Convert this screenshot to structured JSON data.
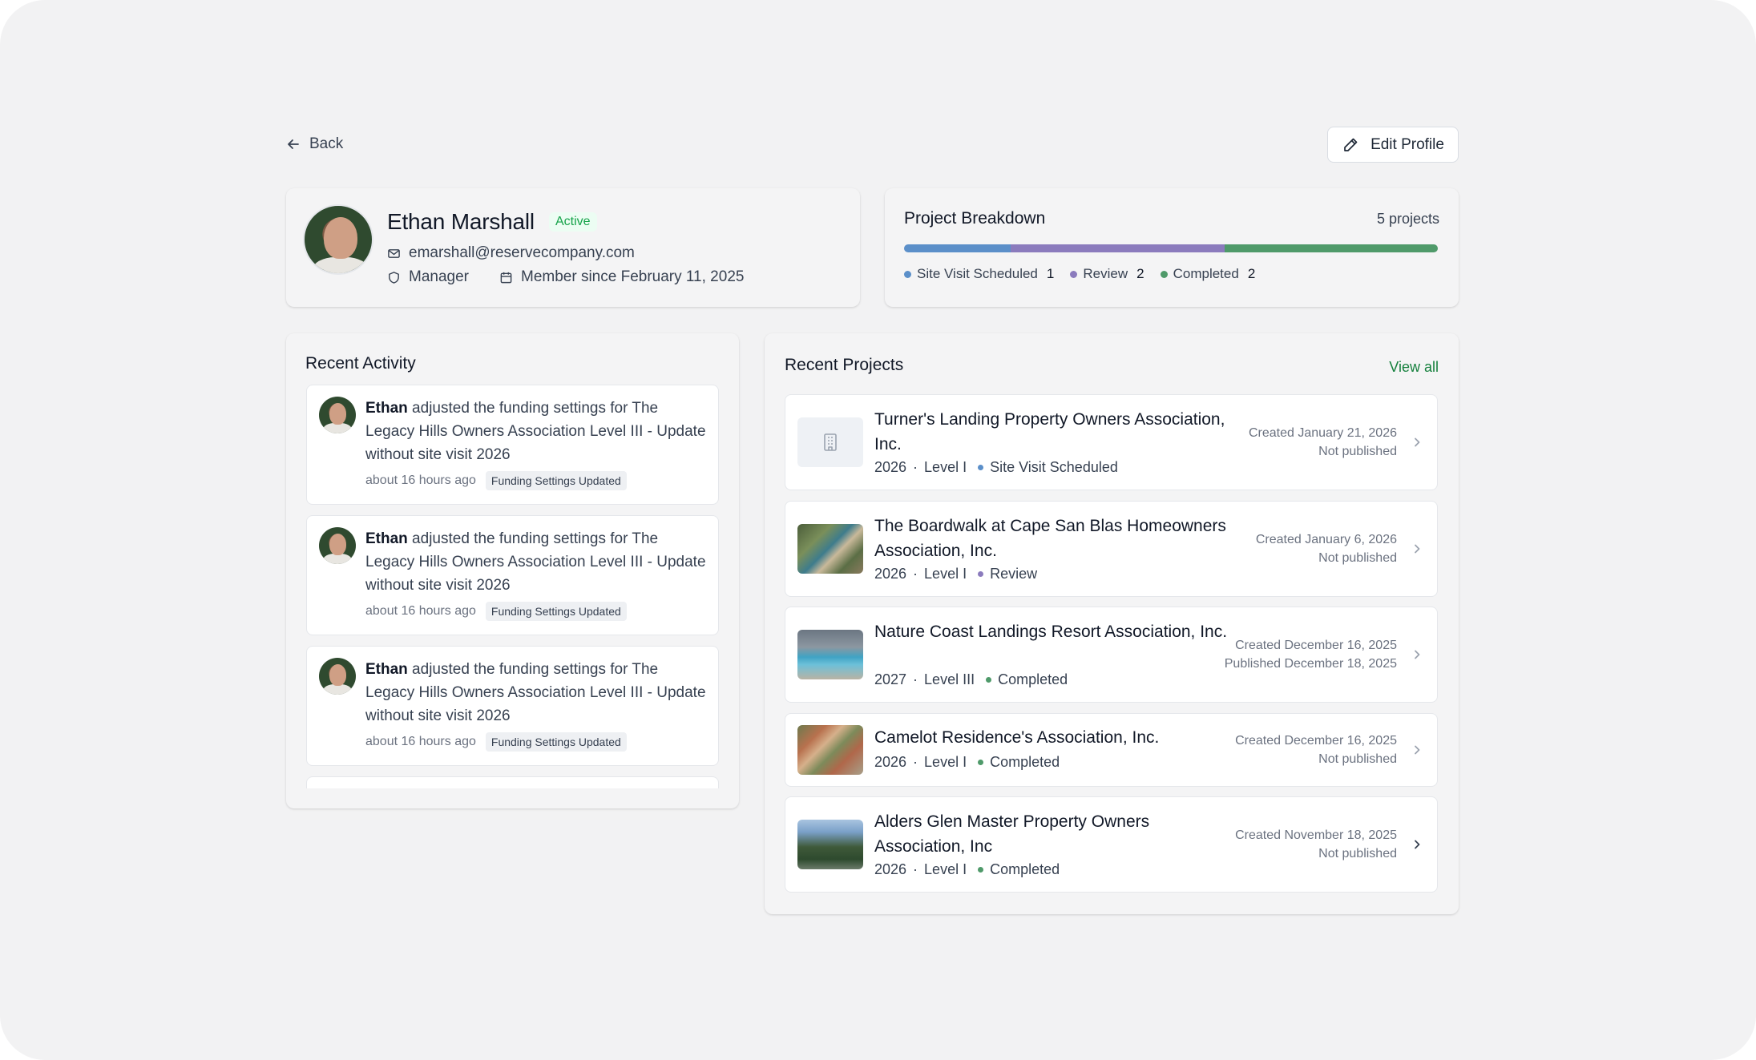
{
  "nav": {
    "back_label": "Back",
    "edit_profile_label": "Edit Profile"
  },
  "profile": {
    "name": "Ethan Marshall",
    "status": "Active",
    "email": "emarshall@reservecompany.com",
    "role": "Manager",
    "member_since": "Member since February 11, 2025"
  },
  "breakdown": {
    "title": "Project Breakdown",
    "count_label": "5 projects",
    "segments": [
      {
        "label": "Site Visit Scheduled",
        "count": "1",
        "value": 1,
        "color": "#5b8fc9"
      },
      {
        "label": "Review",
        "count": "2",
        "value": 2,
        "color": "#8b7bbd"
      },
      {
        "label": "Completed",
        "count": "2",
        "value": 2,
        "color": "#4f9a6a"
      }
    ]
  },
  "activity": {
    "title": "Recent Activity",
    "items": [
      {
        "actor": "Ethan",
        "text": " adjusted the funding settings for The Legacy Hills Owners Association Level III - Update without site visit 2026",
        "time": "about 16 hours ago",
        "tag": "Funding Settings Updated"
      },
      {
        "actor": "Ethan",
        "text": " adjusted the funding settings for The Legacy Hills Owners Association Level III - Update without site visit 2026",
        "time": "about 16 hours ago",
        "tag": "Funding Settings Updated"
      },
      {
        "actor": "Ethan",
        "text": " adjusted the funding settings for The Legacy Hills Owners Association Level III - Update without site visit 2026",
        "time": "about 16 hours ago",
        "tag": "Funding Settings Updated"
      }
    ]
  },
  "projects": {
    "title": "Recent Projects",
    "view_all_label": "View all",
    "items": [
      {
        "name": "Turner's Landing Property Owners Association, Inc.",
        "year": "2026",
        "level": "Level I",
        "status": "Site Visit Scheduled",
        "status_color": "#5b8fc9",
        "created": "Created January 21, 2026",
        "published": "Not published",
        "thumb": "building-icon"
      },
      {
        "name": "The Boardwalk at Cape San Blas Homeowners Association, Inc.",
        "year": "2026",
        "level": "Level I",
        "status": "Review",
        "status_color": "#8b7bbd",
        "created": "Created January 6, 2026",
        "published": "Not published",
        "thumb": "aerial-photo"
      },
      {
        "name": "Nature Coast Landings Resort Association, Inc.",
        "year": "2027",
        "level": "Level III",
        "status": "Completed",
        "status_color": "#4f9a6a",
        "created": "Created December 16, 2025",
        "published": "Published December 18, 2025",
        "thumb": "pool-photo"
      },
      {
        "name": "Camelot Residence's Association, Inc.",
        "year": "2026",
        "level": "Level I",
        "status": "Completed",
        "status_color": "#4f9a6a",
        "created": "Created December 16, 2025",
        "published": "Not published",
        "thumb": "rooftops-photo"
      },
      {
        "name": "Alders Glen Master Property Owners Association, Inc",
        "year": "2026",
        "level": "Level I",
        "status": "Completed",
        "status_color": "#4f9a6a",
        "created": "Created November 18, 2025",
        "published": "Not published",
        "thumb": "trees-photo"
      }
    ]
  }
}
